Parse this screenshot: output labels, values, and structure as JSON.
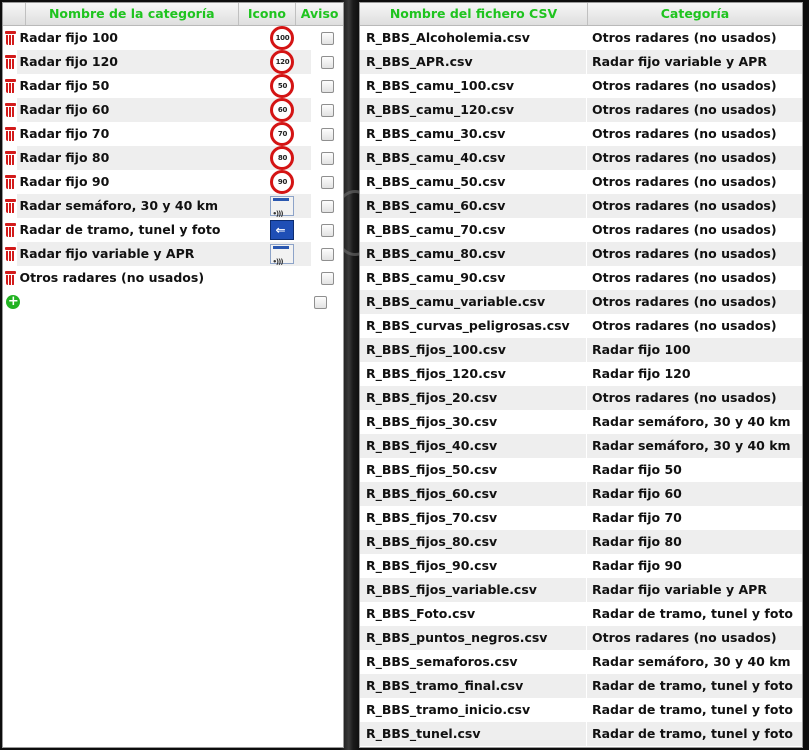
{
  "left": {
    "headers": {
      "name": "Nombre de la categoría",
      "icon": "Icono",
      "alert": "Aviso"
    },
    "rows": [
      {
        "label": "Radar fijo 100",
        "icon": "speed-limit-100-icon",
        "sign": "100"
      },
      {
        "label": "Radar fijo 120",
        "icon": "speed-limit-120-icon",
        "sign": "120"
      },
      {
        "label": "Radar fijo 50",
        "icon": "speed-limit-50-icon",
        "sign": "50"
      },
      {
        "label": "Radar fijo 60",
        "icon": "speed-limit-60-icon",
        "sign": "60"
      },
      {
        "label": "Radar fijo 70",
        "icon": "speed-limit-70-icon",
        "sign": "70"
      },
      {
        "label": "Radar fijo 80",
        "icon": "speed-limit-80-icon",
        "sign": "80"
      },
      {
        "label": "Radar fijo 90",
        "icon": "speed-limit-90-icon",
        "sign": "90"
      },
      {
        "label": "Radar semáforo, 30 y 40 km",
        "icon": "radar-camera-sign-icon",
        "sign": ""
      },
      {
        "label": "Radar de tramo, tunel y foto",
        "icon": "section-radar-sign-icon",
        "sign": ""
      },
      {
        "label": "Radar fijo variable y APR",
        "icon": "radar-camera-sign-icon",
        "sign": ""
      },
      {
        "label": "Otros radares (no usados)",
        "icon": "",
        "sign": ""
      }
    ]
  },
  "right": {
    "headers": {
      "file": "Nombre del fichero CSV",
      "category": "Categoría"
    },
    "rows": [
      {
        "file": "R_BBS_Alcoholemia.csv",
        "category": "Otros radares (no usados)"
      },
      {
        "file": "R_BBS_APR.csv",
        "category": "Radar fijo variable y APR"
      },
      {
        "file": "R_BBS_camu_100.csv",
        "category": "Otros radares (no usados)"
      },
      {
        "file": "R_BBS_camu_120.csv",
        "category": "Otros radares (no usados)"
      },
      {
        "file": "R_BBS_camu_30.csv",
        "category": "Otros radares (no usados)"
      },
      {
        "file": "R_BBS_camu_40.csv",
        "category": "Otros radares (no usados)"
      },
      {
        "file": "R_BBS_camu_50.csv",
        "category": "Otros radares (no usados)"
      },
      {
        "file": "R_BBS_camu_60.csv",
        "category": "Otros radares (no usados)"
      },
      {
        "file": "R_BBS_camu_70.csv",
        "category": "Otros radares (no usados)"
      },
      {
        "file": "R_BBS_camu_80.csv",
        "category": "Otros radares (no usados)"
      },
      {
        "file": "R_BBS_camu_90.csv",
        "category": "Otros radares (no usados)"
      },
      {
        "file": "R_BBS_camu_variable.csv",
        "category": "Otros radares (no usados)"
      },
      {
        "file": "R_BBS_curvas_peligrosas.csv",
        "category": "Otros radares (no usados)"
      },
      {
        "file": "R_BBS_fijos_100.csv",
        "category": "Radar fijo 100"
      },
      {
        "file": "R_BBS_fijos_120.csv",
        "category": "Radar fijo 120"
      },
      {
        "file": "R_BBS_fijos_20.csv",
        "category": "Otros radares (no usados)"
      },
      {
        "file": "R_BBS_fijos_30.csv",
        "category": "Radar semáforo, 30 y 40 km"
      },
      {
        "file": "R_BBS_fijos_40.csv",
        "category": "Radar semáforo, 30 y 40 km"
      },
      {
        "file": "R_BBS_fijos_50.csv",
        "category": "Radar fijo 50"
      },
      {
        "file": "R_BBS_fijos_60.csv",
        "category": "Radar fijo 60"
      },
      {
        "file": "R_BBS_fijos_70.csv",
        "category": "Radar fijo 70"
      },
      {
        "file": "R_BBS_fijos_80.csv",
        "category": "Radar fijo 80"
      },
      {
        "file": "R_BBS_fijos_90.csv",
        "category": "Radar fijo 90"
      },
      {
        "file": "R_BBS_fijos_variable.csv",
        "category": "Radar fijo variable y APR"
      },
      {
        "file": "R_BBS_Foto.csv",
        "category": "Radar de tramo, tunel y foto"
      },
      {
        "file": "R_BBS_puntos_negros.csv",
        "category": "Otros radares (no usados)"
      },
      {
        "file": "R_BBS_semaforos.csv",
        "category": "Radar semáforo, 30 y 40 km"
      },
      {
        "file": "R_BBS_tramo_final.csv",
        "category": "Radar de tramo, tunel y foto"
      },
      {
        "file": "R_BBS_tramo_inicio.csv",
        "category": "Radar de tramo, tunel y foto"
      },
      {
        "file": "R_BBS_tunel.csv",
        "category": "Radar de tramo, tunel y foto"
      }
    ]
  },
  "colors": {
    "header_text": "#1fc41f",
    "delete": "#d21a1a",
    "add": "#22b322",
    "alt_row": "#eeeeee"
  }
}
